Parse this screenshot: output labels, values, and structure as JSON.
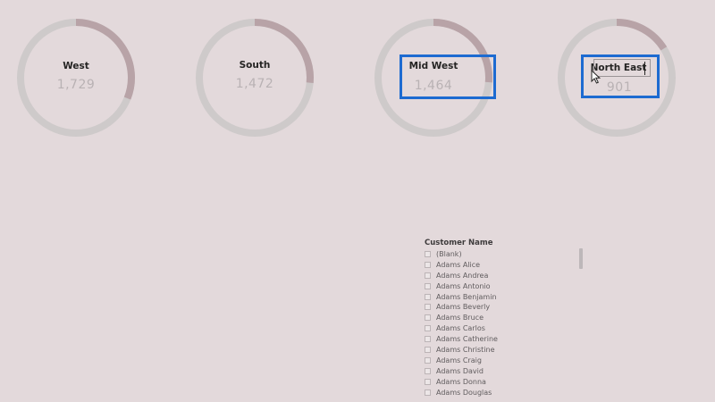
{
  "chart_data": [
    {
      "type": "pie",
      "categories": [
        "West"
      ],
      "label": "West",
      "value_text": "1,729",
      "value": 1729
    },
    {
      "type": "pie",
      "categories": [
        "South"
      ],
      "label": "South",
      "value_text": "1,472",
      "value": 1472
    },
    {
      "type": "pie",
      "categories": [
        "Mid West"
      ],
      "label": "Mid West",
      "value_text": "1,464",
      "value": 1464
    },
    {
      "type": "pie",
      "categories": [
        "North East"
      ],
      "label": "North East",
      "value_text": "901",
      "value": 901
    }
  ],
  "colors": {
    "ring_base": "#cecaca",
    "ring_highlight": "#b8a3a7",
    "selection": "#1d6bd1",
    "background": "#e3d9db"
  },
  "slicer": {
    "title": "Customer Name",
    "items": [
      "(Blank)",
      "Adams Alice",
      "Adams Andrea",
      "Adams Antonio",
      "Adams Benjamin",
      "Adams Beverly",
      "Adams Bruce",
      "Adams Carlos",
      "Adams Catherine",
      "Adams Christine",
      "Adams Craig",
      "Adams David",
      "Adams Donna",
      "Adams Douglas"
    ]
  },
  "icons": {
    "cursor": "mouse-pointer-icon",
    "checkbox": "checkbox-icon"
  }
}
